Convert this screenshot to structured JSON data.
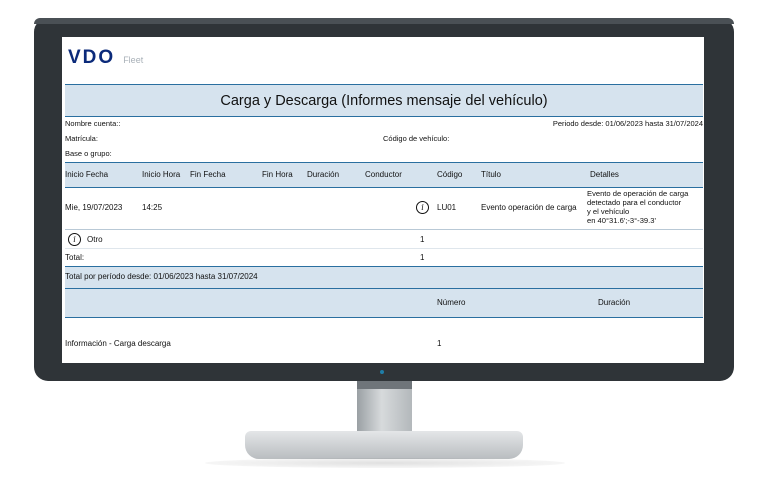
{
  "app": {
    "logo": "VDO",
    "logo_sub": "Fleet"
  },
  "report": {
    "title": "Carga y Descarga (Informes mensaje del vehículo)",
    "account_label": "Nombre cuenta::",
    "period_label": "Periodo desde: 01/06/2023 hasta 31/07/2024",
    "plate_label": "Matrícula:",
    "vehicle_code_label": "Código de vehículo:",
    "group_label": "Base o grupo:"
  },
  "columns": [
    "Inicio Fecha",
    "Inicio Hora",
    "Fin Fecha",
    "Fin Hora",
    "Duración",
    "Conductor",
    "Código",
    "Título",
    "Detalles"
  ],
  "rows": [
    {
      "start_date": "Mie, 19/07/2023",
      "start_time": "14:25",
      "code": "LU01",
      "title": "Evento operación de carga",
      "details": [
        "Evento de operación de carga",
        "detectado para el conductor",
        "y el vehículo",
        "en 40°31.6';-3°-39.3'"
      ],
      "icon": "info-icon"
    }
  ],
  "other_row": {
    "label": "Otro",
    "count": "1",
    "icon": "info-icon"
  },
  "total_row": {
    "label": "Total:",
    "count": "1"
  },
  "period_total": {
    "label": "Total por período desde: 01/06/2023 hasta 31/07/2024"
  },
  "summary": {
    "headers": {
      "number": "Número",
      "duration": "Duración"
    },
    "row": {
      "label": "Información - Carga descarga",
      "number": "1"
    }
  },
  "colors": {
    "header_bg": "#d6e3ee",
    "accent": "#2a6fa0",
    "logo": "#0b2a7a",
    "bezel": "#2f3438"
  }
}
